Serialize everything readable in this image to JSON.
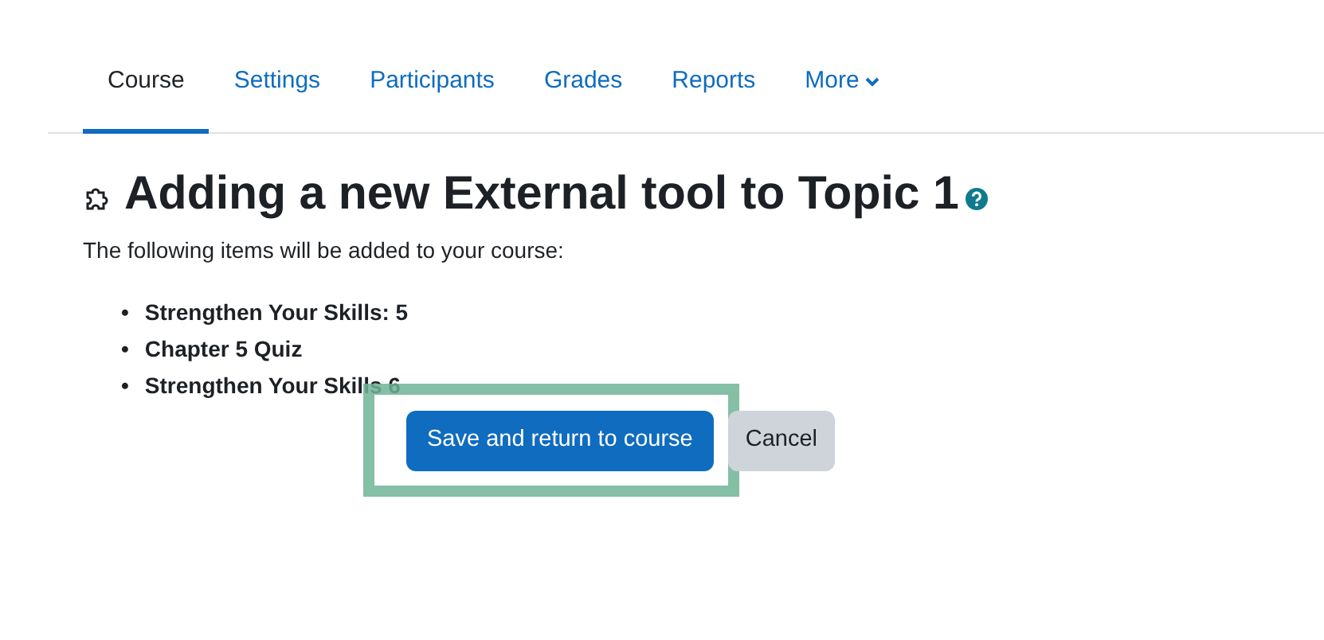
{
  "tabs": [
    {
      "label": "Course",
      "selected": true
    },
    {
      "label": "Settings",
      "selected": false
    },
    {
      "label": "Participants",
      "selected": false
    },
    {
      "label": "Grades",
      "selected": false
    },
    {
      "label": "Reports",
      "selected": false
    },
    {
      "label": "More",
      "selected": false,
      "dropdown": true
    }
  ],
  "heading": "Adding a new External tool to Topic 1",
  "intro": "The following items will be added to your course:",
  "items": [
    {
      "bullet": "•",
      "text": "Strengthen Your Skills: 5"
    },
    {
      "bullet": "•",
      "text": "Chapter 5 Quiz"
    },
    {
      "bullet": "•",
      "text": "Strengthen Your Skills 6"
    }
  ],
  "buttons": [
    {
      "label": "Save and return to course",
      "kind": "primary",
      "highlighted": true
    },
    {
      "label": "Cancel",
      "kind": "secondary",
      "highlighted": false
    }
  ]
}
